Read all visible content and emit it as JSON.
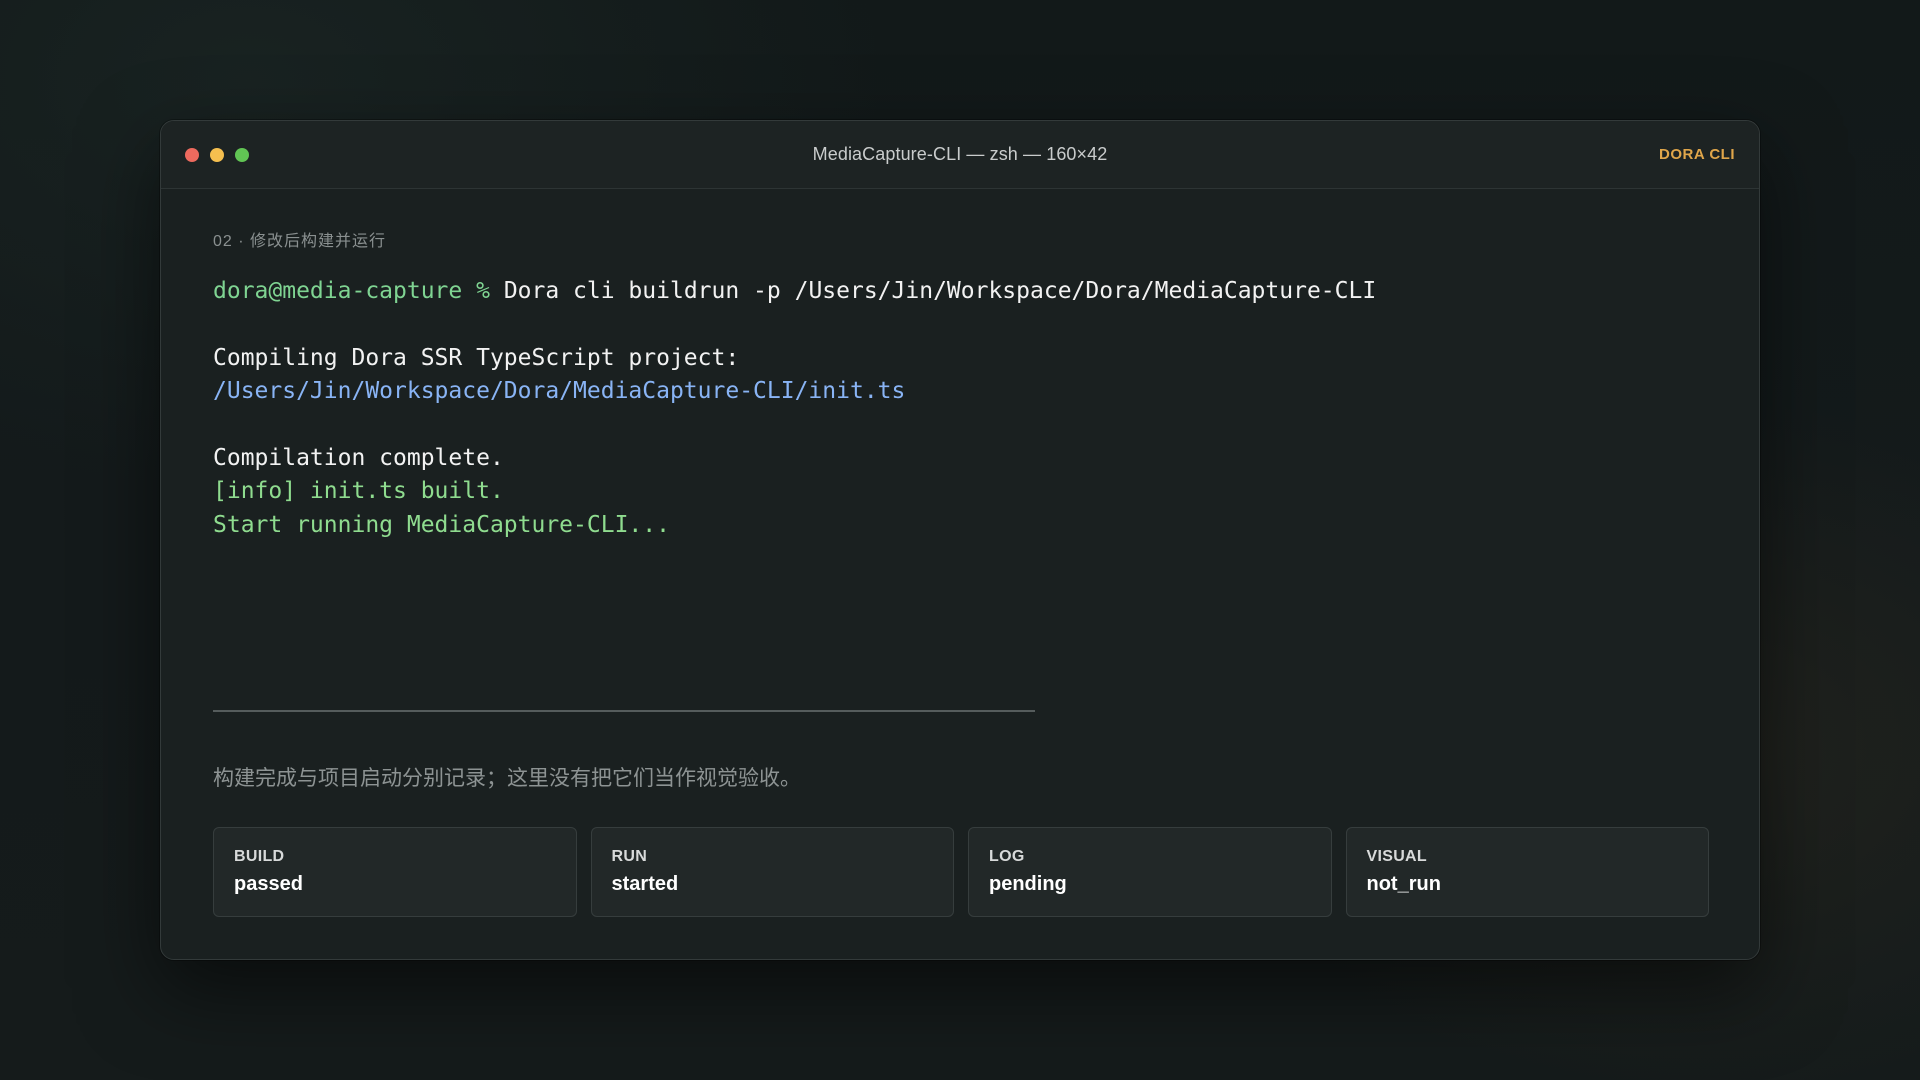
{
  "window": {
    "title": "MediaCapture-CLI — zsh — 160×42",
    "brand": "DORA CLI",
    "traffic_lights": [
      "close",
      "minimize",
      "zoom"
    ]
  },
  "terminal": {
    "step_label": "02 · 修改后构建并运行",
    "prompt": "dora@media-capture %",
    "command": "Dora cli buildrun -p /Users/Jin/Workspace/Dora/MediaCapture-CLI",
    "compiling_text": "Compiling Dora SSR TypeScript project:",
    "compiling_path": "/Users/Jin/Workspace/Dora/MediaCapture-CLI/init.ts",
    "compilation_complete": "Compilation complete.",
    "info_line": "[info] init.ts built.",
    "running_line": "Start running MediaCapture-CLI..."
  },
  "note": "构建完成与项目启动分别记录；这里没有把它们当作视觉验收。",
  "status_cards": [
    {
      "label": "BUILD",
      "value": "passed"
    },
    {
      "label": "RUN",
      "value": "started"
    },
    {
      "label": "LOG",
      "value": "pending"
    },
    {
      "label": "VISUAL",
      "value": "not_run"
    }
  ],
  "colors": {
    "prompt": "#7fd492",
    "path": "#89b4f5",
    "success_text": "#8fdc8f",
    "brand": "#e0a64a",
    "close": "#ed6a5e",
    "minimize": "#f5bf4f",
    "zoom": "#61c554"
  }
}
